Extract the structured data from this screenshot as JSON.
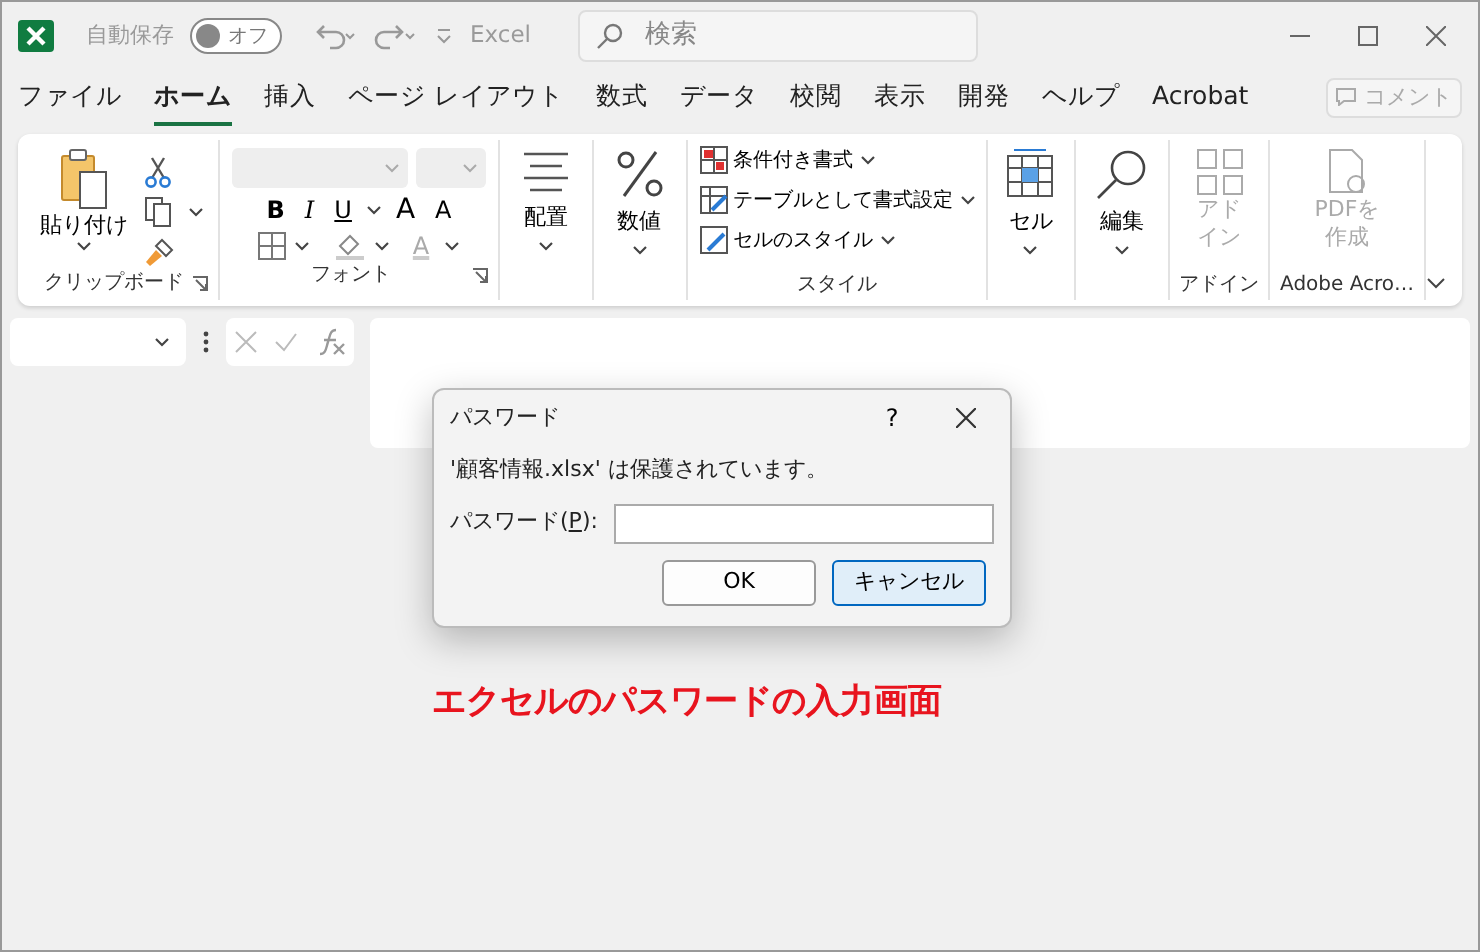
{
  "title_bar": {
    "autosave_label": "自動保存",
    "autosave_toggle": {
      "label": "オフ",
      "on": false
    },
    "app_name": "Excel",
    "search": {
      "placeholder": "検索"
    }
  },
  "menu_tabs": [
    {
      "label": "ファイル",
      "selected": false
    },
    {
      "label": "ホーム",
      "selected": true
    },
    {
      "label": "挿入",
      "selected": false
    },
    {
      "label": "ページ レイアウト",
      "selected": false
    },
    {
      "label": "数式",
      "selected": false
    },
    {
      "label": "データ",
      "selected": false
    },
    {
      "label": "校閲",
      "selected": false
    },
    {
      "label": "表示",
      "selected": false
    },
    {
      "label": "開発",
      "selected": false
    },
    {
      "label": "ヘルプ",
      "selected": false
    },
    {
      "label": "Acrobat",
      "selected": false
    }
  ],
  "comment_button": {
    "label": "コメント",
    "disabled": true
  },
  "ribbon": {
    "clipboard": {
      "paste": "貼り付け",
      "label": "クリップボード"
    },
    "font": {
      "style_buttons": [
        "B",
        "I",
        "U"
      ],
      "grow": "A",
      "shrink": "A",
      "font_color": "A",
      "label": "フォント"
    },
    "alignment": {
      "label": "配置"
    },
    "number": {
      "label": "数値"
    },
    "styles": {
      "items": [
        "条件付き書式",
        "テーブルとして書式設定",
        "セルのスタイル"
      ],
      "label": "スタイル"
    },
    "cells": {
      "label": "セル"
    },
    "editing": {
      "label": "編集"
    },
    "addins": {
      "button": "アドイン",
      "label": "アドイン",
      "disabled": true
    },
    "acrobat": {
      "button": "PDFを作成",
      "label": "Adobe Acro…",
      "disabled": true
    }
  },
  "dialog": {
    "title": "パスワード",
    "help": "?",
    "message": "'顧客情報.xlsx' は保護されています。",
    "field_label": "パスワード(P):",
    "access_key_underlined": true,
    "buttons": [
      {
        "label": "OK",
        "focused": false
      },
      {
        "label": "キャンセル",
        "focused": true
      }
    ]
  },
  "caption": "エクセルのパスワードの入力画面"
}
